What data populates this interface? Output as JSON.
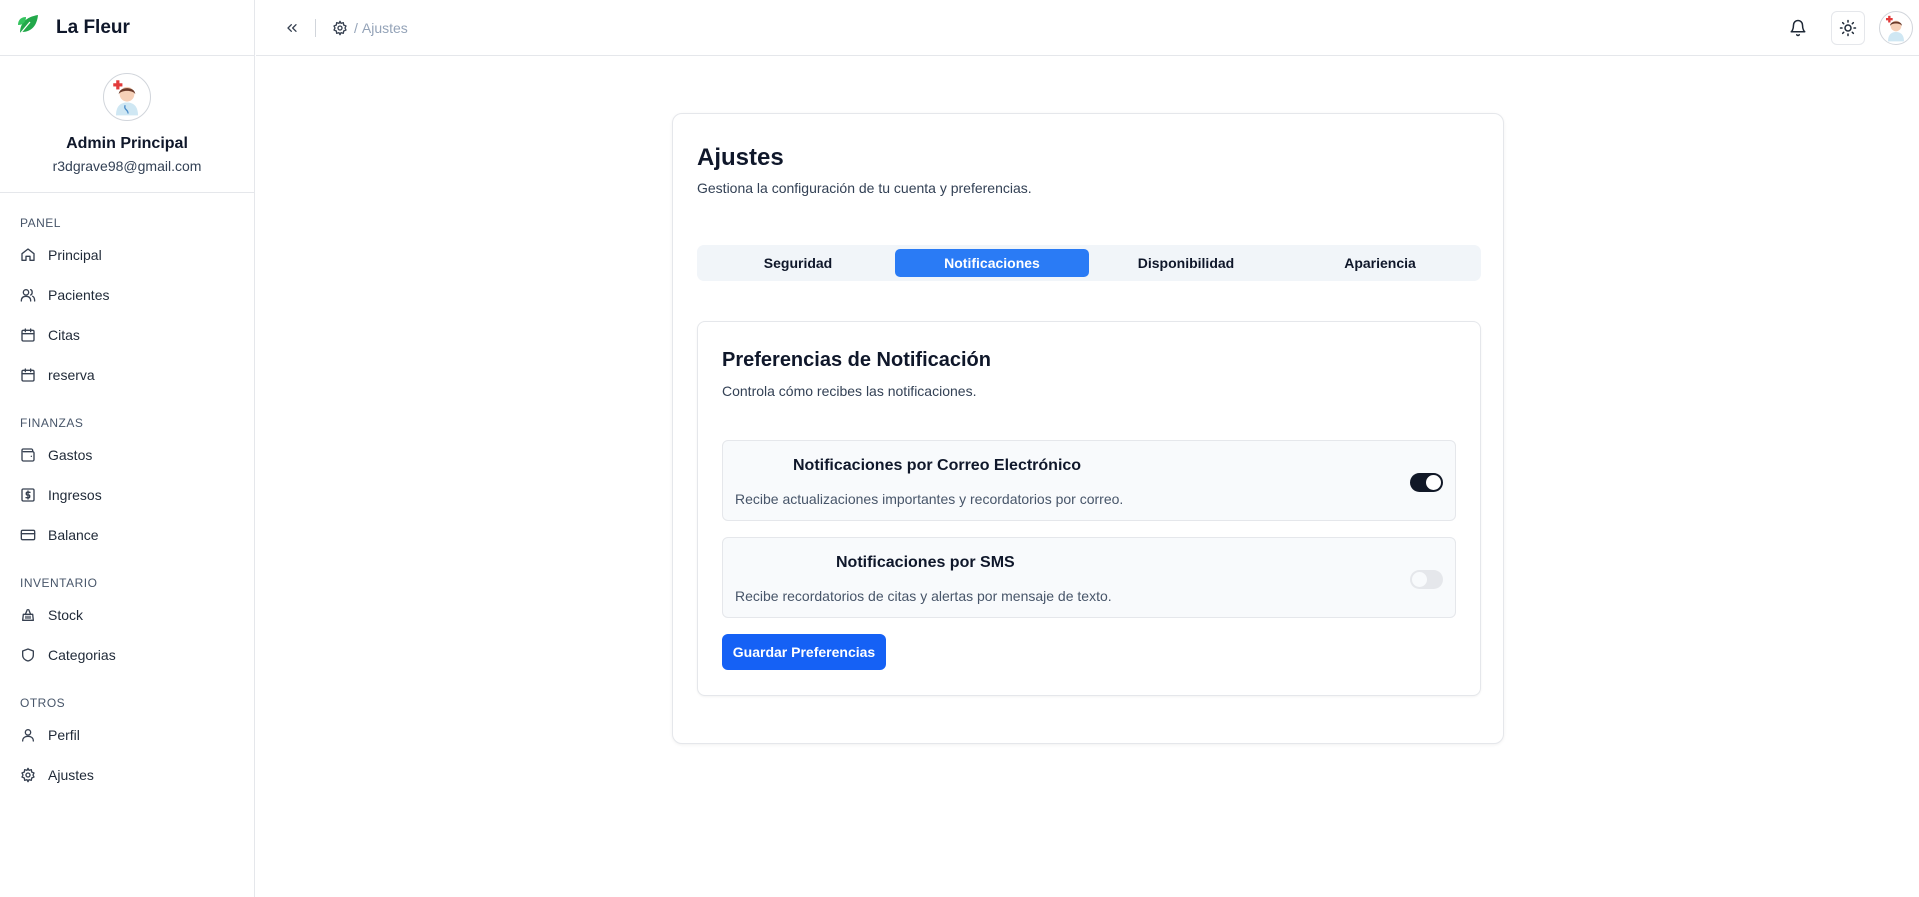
{
  "app": {
    "brand_name": "La Fleur",
    "accent_color": "#2a7bf5",
    "primary_button_color": "#1561f5",
    "logo_icon": "leaf-icon"
  },
  "user": {
    "name": "Admin Principal",
    "email": "r3dgrave98@gmail.com",
    "avatar_icon": "doctor-avatar-icon"
  },
  "sidebar": {
    "sections": [
      {
        "title": "PANEL",
        "items": [
          {
            "label": "Principal",
            "icon": "home-icon"
          },
          {
            "label": "Pacientes",
            "icon": "users-icon"
          },
          {
            "label": "Citas",
            "icon": "calendar-icon"
          },
          {
            "label": "reserva",
            "icon": "calendar-icon"
          }
        ]
      },
      {
        "title": "FINANZAS",
        "items": [
          {
            "label": "Gastos",
            "icon": "wallet-icon"
          },
          {
            "label": "Ingresos",
            "icon": "dollar-icon"
          },
          {
            "label": "Balance",
            "icon": "credit-card-icon"
          }
        ]
      },
      {
        "title": "INVENTARIO",
        "items": [
          {
            "label": "Stock",
            "icon": "basket-icon"
          },
          {
            "label": "Categorias",
            "icon": "shield-icon"
          }
        ]
      },
      {
        "title": "OTROS",
        "items": [
          {
            "label": "Perfil",
            "icon": "user-icon"
          },
          {
            "label": "Ajustes",
            "icon": "gear-icon"
          }
        ]
      }
    ]
  },
  "header": {
    "breadcrumb_separator": "/",
    "breadcrumb_label": "Ajustes"
  },
  "settings": {
    "title": "Ajustes",
    "subtitle": "Gestiona la configuración de tu cuenta y preferencias.",
    "tabs": [
      {
        "label": "Seguridad",
        "active": false
      },
      {
        "label": "Notificaciones",
        "active": true
      },
      {
        "label": "Disponibilidad",
        "active": false
      },
      {
        "label": "Apariencia",
        "active": false
      }
    ],
    "notifications": {
      "title": "Preferencias de Notificación",
      "subtitle": "Controla cómo recibes las notificaciones.",
      "email": {
        "title": "Notificaciones por Correo Electrónico",
        "description": "Recibe actualizaciones importantes y recordatorios por correo.",
        "enabled": true
      },
      "sms": {
        "title": "Notificaciones por SMS",
        "description": "Recibe recordatorios de citas y alertas por mensaje de texto.",
        "enabled": false
      },
      "save_label": "Guardar Preferencias"
    }
  }
}
